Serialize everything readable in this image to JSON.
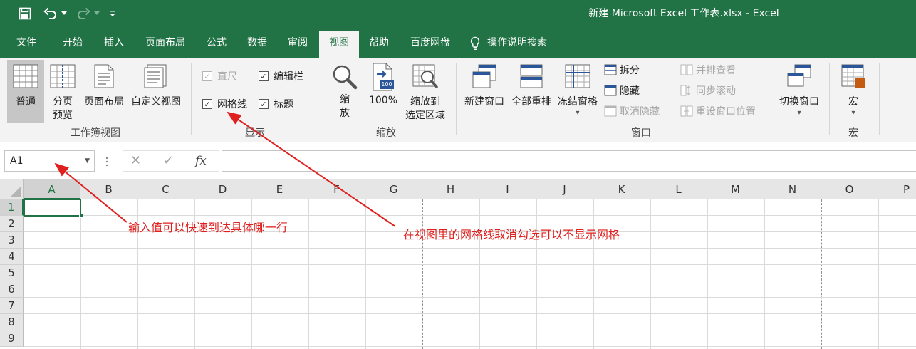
{
  "window": {
    "title": "新建 Microsoft Excel 工作表.xlsx  -  Excel",
    "accent_color": "#217346",
    "quick_access": [
      "save-icon",
      "undo-icon",
      "redo-icon",
      "customize-icon"
    ]
  },
  "tabs": [
    {
      "label": "文件",
      "active": false
    },
    {
      "label": "开始",
      "active": false
    },
    {
      "label": "插入",
      "active": false
    },
    {
      "label": "页面布局",
      "active": false
    },
    {
      "label": "公式",
      "active": false
    },
    {
      "label": "数据",
      "active": false
    },
    {
      "label": "审阅",
      "active": false
    },
    {
      "label": "视图",
      "active": true
    },
    {
      "label": "帮助",
      "active": false
    },
    {
      "label": "百度网盘",
      "active": false
    },
    {
      "label": "操作说明搜索",
      "active": false,
      "icon": "lightbulb-icon"
    }
  ],
  "ribbon": {
    "workbook_views": {
      "group_label": "工作簿视图",
      "normal": "普通",
      "page_break_line1": "分页",
      "page_break_line2": "预览",
      "page_layout": "页面布局",
      "custom_views": "自定义视图"
    },
    "show": {
      "group_label": "显示",
      "ruler": {
        "label": "直尺",
        "checked": true,
        "disabled": true
      },
      "formula_bar": {
        "label": "编辑栏",
        "checked": true
      },
      "gridlines": {
        "label": "网格线",
        "checked": true
      },
      "headings": {
        "label": "标题",
        "checked": true
      },
      "check_mark": "✓"
    },
    "zoom": {
      "group_label": "缩放",
      "zoom_line1": "缩",
      "zoom_line2": "放",
      "zoom_100": "100%",
      "icon_badge": "100",
      "zoom_selection_line1": "缩放到",
      "zoom_selection_line2": "选定区域"
    },
    "window": {
      "group_label": "窗口",
      "new_window": "新建窗口",
      "arrange_all": "全部重排",
      "freeze_panes": "冻结窗格",
      "split": "拆分",
      "hide": "隐藏",
      "unhide": "取消隐藏",
      "side_by_side": "并排查看",
      "sync_scroll": "同步滚动",
      "reset_position": "重设窗口位置",
      "switch_windows": "切换窗口",
      "dropdown_glyph": "▾"
    },
    "macros": {
      "group_label": "宏",
      "macros": "宏"
    }
  },
  "formula_bar": {
    "name_box": "A1",
    "cancel_glyph": "✕",
    "enter_glyph": "✓",
    "fx_label": "fx",
    "formula": ""
  },
  "sheet": {
    "columns": [
      "A",
      "B",
      "C",
      "D",
      "E",
      "F",
      "G",
      "H",
      "I",
      "J",
      "K",
      "L",
      "M",
      "N",
      "O",
      "P"
    ],
    "rows": [
      "1",
      "2",
      "3",
      "4",
      "5",
      "6",
      "7",
      "8",
      "9"
    ],
    "selected_cell": "A1"
  },
  "annotations": {
    "name_box_note": "输入值可以快速到达具体哪一行",
    "gridlines_note": "在视图里的网格线取消勾选可以不显示网格",
    "color": "#e0201e"
  }
}
